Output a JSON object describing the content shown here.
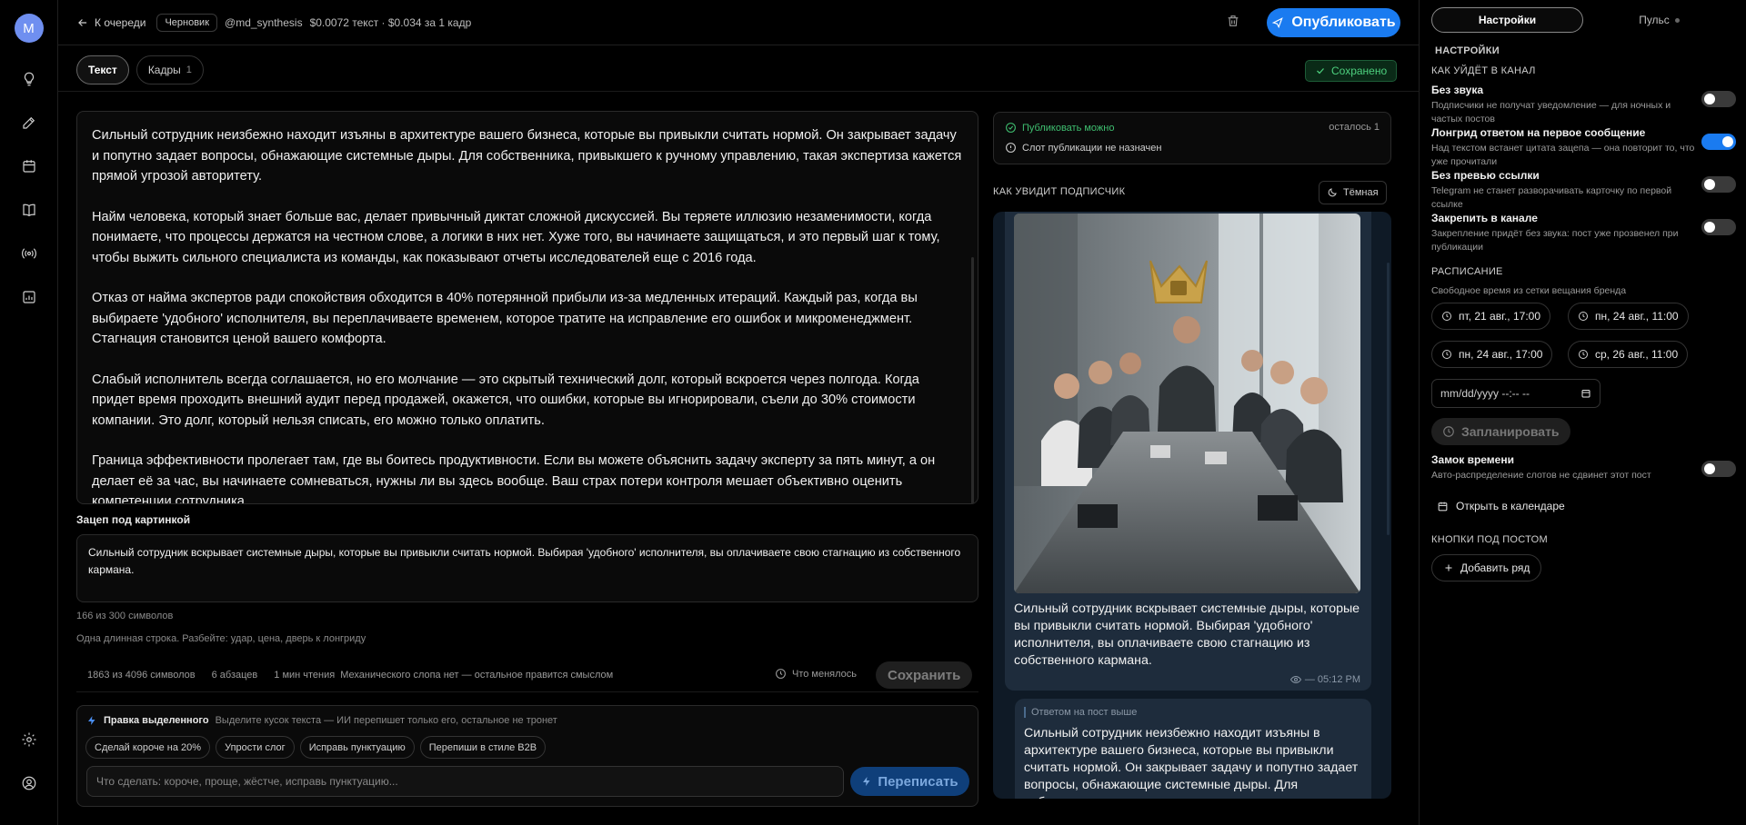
{
  "user": {
    "avatar_letter": "M"
  },
  "topbar": {
    "back_label": "К очереди",
    "status_chip": "Черновик",
    "channel": "@md_synthesis",
    "cost": "$0.0072 текст · $0.034 за 1 кадр",
    "publish_label": "Опубликовать"
  },
  "tabs": [
    {
      "label": "Текст"
    },
    {
      "label": "Кадры",
      "count": "1"
    }
  ],
  "saved_label": "Сохранено",
  "editor": {
    "paragraphs": [
      "Сильный сотрудник неизбежно находит изъяны в архитектуре вашего бизнеса, которые вы привыкли считать нормой. Он закрывает задачу и попутно задает вопросы, обнажающие системные дыры. Для собственника, привыкшего к ручному управлению, такая экспертиза кажется прямой угрозой авторитету.",
      "Найм человека, который знает больше вас, делает привычный диктат сложной дискуссией. Вы теряете иллюзию незаменимости, когда понимаете, что процессы держатся на честном слове, а логики в них нет. Хуже того, вы начинаете защищаться, и это первый шаг к тому, чтобы выжить сильного специалиста из команды, как показывают отчеты исследователей еще с 2016 года.",
      "Отказ от найма экспертов ради спокойствия обходится в 40% потерянной прибыли из-за медленных итераций. Каждый раз, когда вы выбираете 'удобного' исполнителя, вы переплачиваете временем, которое тратите на исправление его ошибок и микроменеджмент. Стагнация становится ценой вашего комфорта.",
      "Слабый исполнитель всегда соглашается, но его молчание — это скрытый технический долг, который вскроется через полгода. Когда придет время проходить внешний аудит перед продажей, окажется, что ошибки, которые вы игнорировали, съели до 30% стоимости компании. Это долг, который нельзя списать, его можно только оплатить.",
      "Граница эффективности пролегает там, где вы боитесь продуктивности. Если вы можете объяснить задачу эксперту за пять минут, а он делает её за час, вы начинаете сомневаться, нужны ли вы здесь вообще. Ваш страх потери контроля мешает объективно оценить компетенции сотрудника."
    ]
  },
  "hook": {
    "label": "Зацеп под картинкой",
    "text": "Сильный сотрудник вскрывает системные дыры, которые вы привыкли считать нормой. Выбирая 'удобного' исполнителя, вы оплачиваете свою стагнацию из собственного кармана.",
    "count": "166 из 300 символов",
    "hint": "Одна длинная строка. Разбейте: удар, цена, дверь к лонгриду"
  },
  "stats": {
    "chars": "1863 из 4096 символов",
    "paragraphs": "6 абзацев",
    "read_time": "1 мин чтения",
    "slop": "Механического слопа нет — остальное правится смыслом",
    "changes_label": "Что менялось",
    "save_label": "Сохранить"
  },
  "ai_edit": {
    "title": "Правка выделенного",
    "subtitle": "Выделите кусок текста — ИИ перепишет только его, остальное не тронет",
    "chips": [
      "Сделай короче на 20%",
      "Упрости слог",
      "Исправь пунктуацию",
      "Перепиши в стиле B2B"
    ],
    "placeholder": "Что сделать: короче, проще, жёстче, исправь пунктуацию...",
    "rewrite_label": "Переписать"
  },
  "status": {
    "can_publish": "Публиковать можно",
    "remaining": "осталось 1",
    "slot": "Слот публикации не назначен"
  },
  "preview": {
    "title": "КАК УВИДИТ ПОДПИСЧИК",
    "theme_label": "Тёмная",
    "post_text": "Сильный сотрудник вскрывает системные дыры, которые вы привыкли считать нормой. Выбирая 'удобного' исполнителя, вы оплачиваете свою стагнацию из собственного кармана.",
    "time": "— 05:12 PM",
    "reply_quote": "Ответом на пост выше",
    "reply_text": "Сильный сотрудник неизбежно находит изъяны в архитектуре вашего бизнеса, которые вы привыкли считать нормой. Он закрывает задачу и попутно задает вопросы, обнажающие системные дыры. Для собственника, привыкшего к ручному управлению, такая экспертиза"
  },
  "right_panel": {
    "tab_settings": "Настройки",
    "tab_pulse": "Пульс",
    "heading": "НАСТРОЙКИ",
    "section_channel": "КАК УЙДЁТ В КАНАЛ",
    "options": [
      {
        "title": "Без звука",
        "desc": "Подписчики не получат уведомление — для ночных и частых постов",
        "on": false
      },
      {
        "title": "Лонгрид ответом на первое сообщение",
        "desc": "Над текстом встанет цитата зацепа — она повторит то, что уже прочитали",
        "on": true
      },
      {
        "title": "Без превью ссылки",
        "desc": "Telegram не станет разворачивать карточку по первой ссылке",
        "on": false
      },
      {
        "title": "Закрепить в канале",
        "desc": "Закрепление придёт без звука: пост уже прозвенел при публикации",
        "on": false
      }
    ],
    "section_schedule": "РАСПИСАНИЕ",
    "schedule_hint": "Свободное время из сетки вещания бренда",
    "slots": [
      "пт, 21 авг., 17:00",
      "пн, 24 авг., 11:00",
      "пн, 24 авг., 17:00",
      "ср, 26 авг., 11:00"
    ],
    "date_placeholder": "mm/dd/yyyy --:-- --",
    "plan_label": "Запланировать",
    "lock": {
      "title": "Замок времени",
      "desc": "Авто-распределение слотов не сдвинет этот пост",
      "on": false
    },
    "calendar_link": "Открыть в календаре",
    "section_buttons": "КНОПКИ ПОД ПОСТОМ",
    "add_row": "Добавить ряд"
  },
  "colors": {
    "accent": "#1a7bf0",
    "success": "#3fbf70",
    "telegram_bg": "#0f1a26",
    "bubble": "#1e2c3c"
  }
}
